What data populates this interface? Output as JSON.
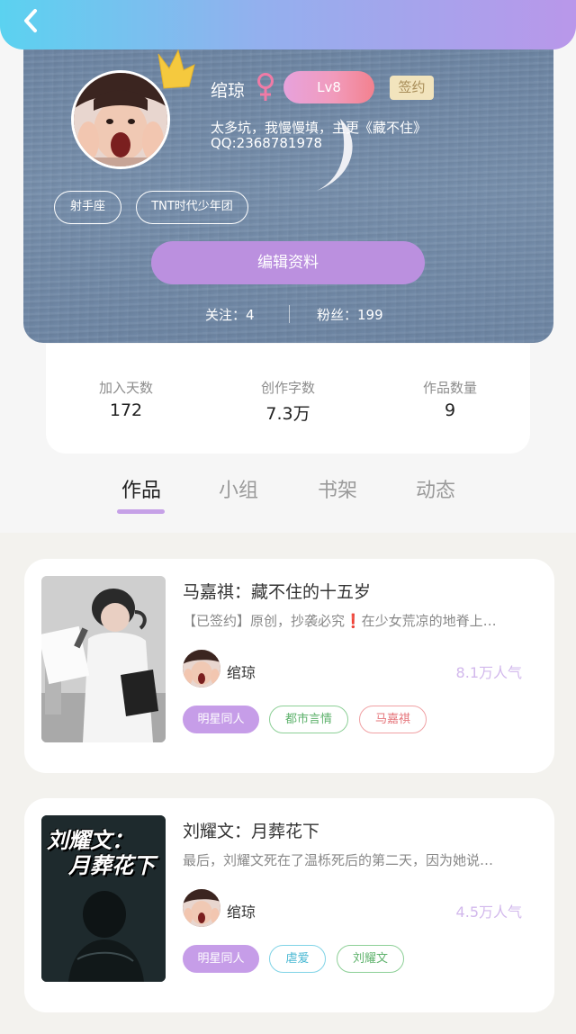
{
  "header": {
    "back_icon": "chevron-left-icon"
  },
  "profile": {
    "name": "绾琼",
    "gender_icon": "female-icon",
    "level": "Lv8",
    "signed_badge": "签约",
    "bio": "太多坑，我慢慢填，主更《藏不住》",
    "qq": "QQ:2368781978",
    "tags": [
      "射手座",
      "TNT时代少年团"
    ],
    "edit_button": "编辑资料",
    "following": "关注：4",
    "fans": "粉丝：199"
  },
  "stats": [
    {
      "label": "加入天数",
      "value": "172"
    },
    {
      "label": "创作字数",
      "value": "7.3万"
    },
    {
      "label": "作品数量",
      "value": "9"
    }
  ],
  "tabs": [
    {
      "label": "作品",
      "active": true
    },
    {
      "label": "小组",
      "active": false
    },
    {
      "label": "书架",
      "active": false
    },
    {
      "label": "动态",
      "active": false
    }
  ],
  "works": [
    {
      "title": "马嘉祺：藏不住的十五岁",
      "description": "【已签约】原创，抄袭必究❗在少女荒凉的地脊上…",
      "author": "绾琼",
      "popularity": "8.1万人气",
      "chips": [
        "明星同人",
        "都市言情",
        "马嘉祺"
      ]
    },
    {
      "title": "刘耀文：月葬花下",
      "description": "最后，刘耀文死在了温栎死后的第二天，因为她说…",
      "author": "绾琼",
      "popularity": "4.5万人气",
      "cover_text": [
        "刘耀文：",
        "月葬花下"
      ],
      "chips": [
        "明星同人",
        "虐爱",
        "刘耀文"
      ]
    }
  ],
  "colors": {
    "accent": "#bb90df",
    "header_gradient": [
      "#5bd2f0",
      "#b997ea"
    ],
    "card_bg": "#7890ad",
    "popularity": "#d2b8ec"
  }
}
